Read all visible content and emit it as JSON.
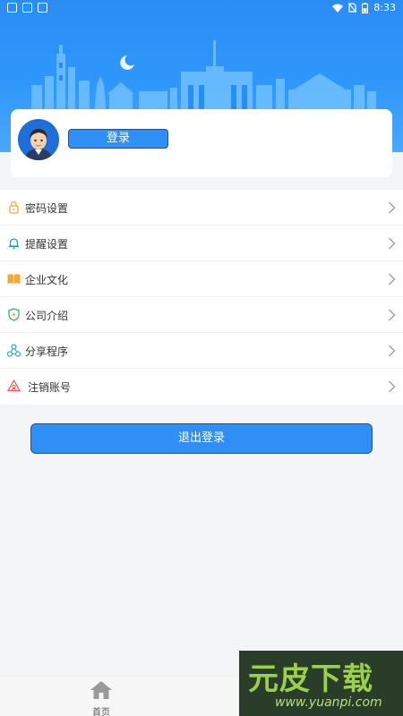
{
  "status_bar": {
    "time": "8:33"
  },
  "profile": {
    "login_label": "登录"
  },
  "menu": {
    "items": [
      {
        "label": "密码设置",
        "icon": "lock-icon",
        "color": "#f0a93b"
      },
      {
        "label": "提醒设置",
        "icon": "bell-icon",
        "color": "#1aa3a3"
      },
      {
        "label": "企业文化",
        "icon": "book-icon",
        "color": "#f0a93b"
      },
      {
        "label": "公司介绍",
        "icon": "shield-icon",
        "color": "#3cb371"
      },
      {
        "label": "分享程序",
        "icon": "share-icon",
        "color": "#2bb3b3"
      },
      {
        "label": "注销账号",
        "icon": "cancel-account-icon",
        "color": "#e65a4f"
      }
    ]
  },
  "logout": {
    "label": "退出登录"
  },
  "tabbar": {
    "home_label": "首页"
  },
  "watermark": {
    "main": "元皮下载",
    "url": "www.yuanpi.com"
  },
  "colors": {
    "primary": "#2f8ff5",
    "hero": "#2a8df6"
  }
}
